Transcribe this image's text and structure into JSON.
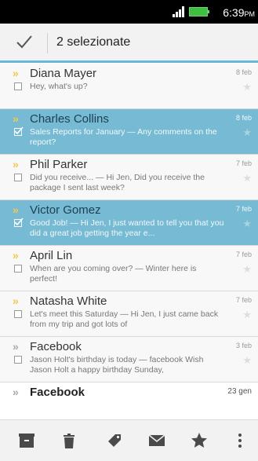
{
  "status_bar": {
    "time": "6:39",
    "ampm": "PM"
  },
  "action_bar": {
    "selection_label": "2 selezionate"
  },
  "emails": [
    {
      "sender": "Diana Mayer",
      "preview": "Hey, what's up?",
      "date": "8 feb",
      "selected": false,
      "arrow": "yellow"
    },
    {
      "sender": "Charles Collins",
      "preview": "Sales Reports for January — Any comments on the report?",
      "date": "8 feb",
      "selected": true,
      "arrow": "yellow"
    },
    {
      "sender": "Phil Parker",
      "preview": "Did you receive... — Hi Jen, Did you receive the package I sent last week?",
      "date": "7 feb",
      "selected": false,
      "arrow": "yellow"
    },
    {
      "sender": "Victor Gomez",
      "preview": "Good Job! — Hi Jen, I just wanted to tell you that you did a great job getting the year e...",
      "date": "7 feb",
      "selected": true,
      "arrow": "yellow"
    },
    {
      "sender": "April Lin",
      "preview": "When are you coming over? — Winter here is perfect!",
      "date": "7 feb",
      "selected": false,
      "arrow": "yellow"
    },
    {
      "sender": "Natasha White",
      "preview": "Let's meet this Saturday — Hi Jen, I just came back from my trip and got lots of",
      "date": "7 feb",
      "selected": false,
      "arrow": "yellow"
    },
    {
      "sender": "Facebook",
      "preview": "Jason Holt's birthday is today — facebook Wish Jason Holt a happy birthday Sunday,",
      "date": "3 feb",
      "selected": false,
      "arrow": "grey"
    },
    {
      "sender": "Facebook",
      "preview": "",
      "date": "23 gen",
      "selected": false,
      "arrow": "grey"
    }
  ],
  "toolbar": {
    "buttons": [
      "archive-icon",
      "trash-icon",
      "tag-icon",
      "mail-icon",
      "star-icon",
      "overflow-menu-icon"
    ]
  },
  "colors": {
    "selected_row": "#76bad3",
    "accent_line": "#66b8de",
    "toolbar_icon": "#4a4a4a"
  }
}
